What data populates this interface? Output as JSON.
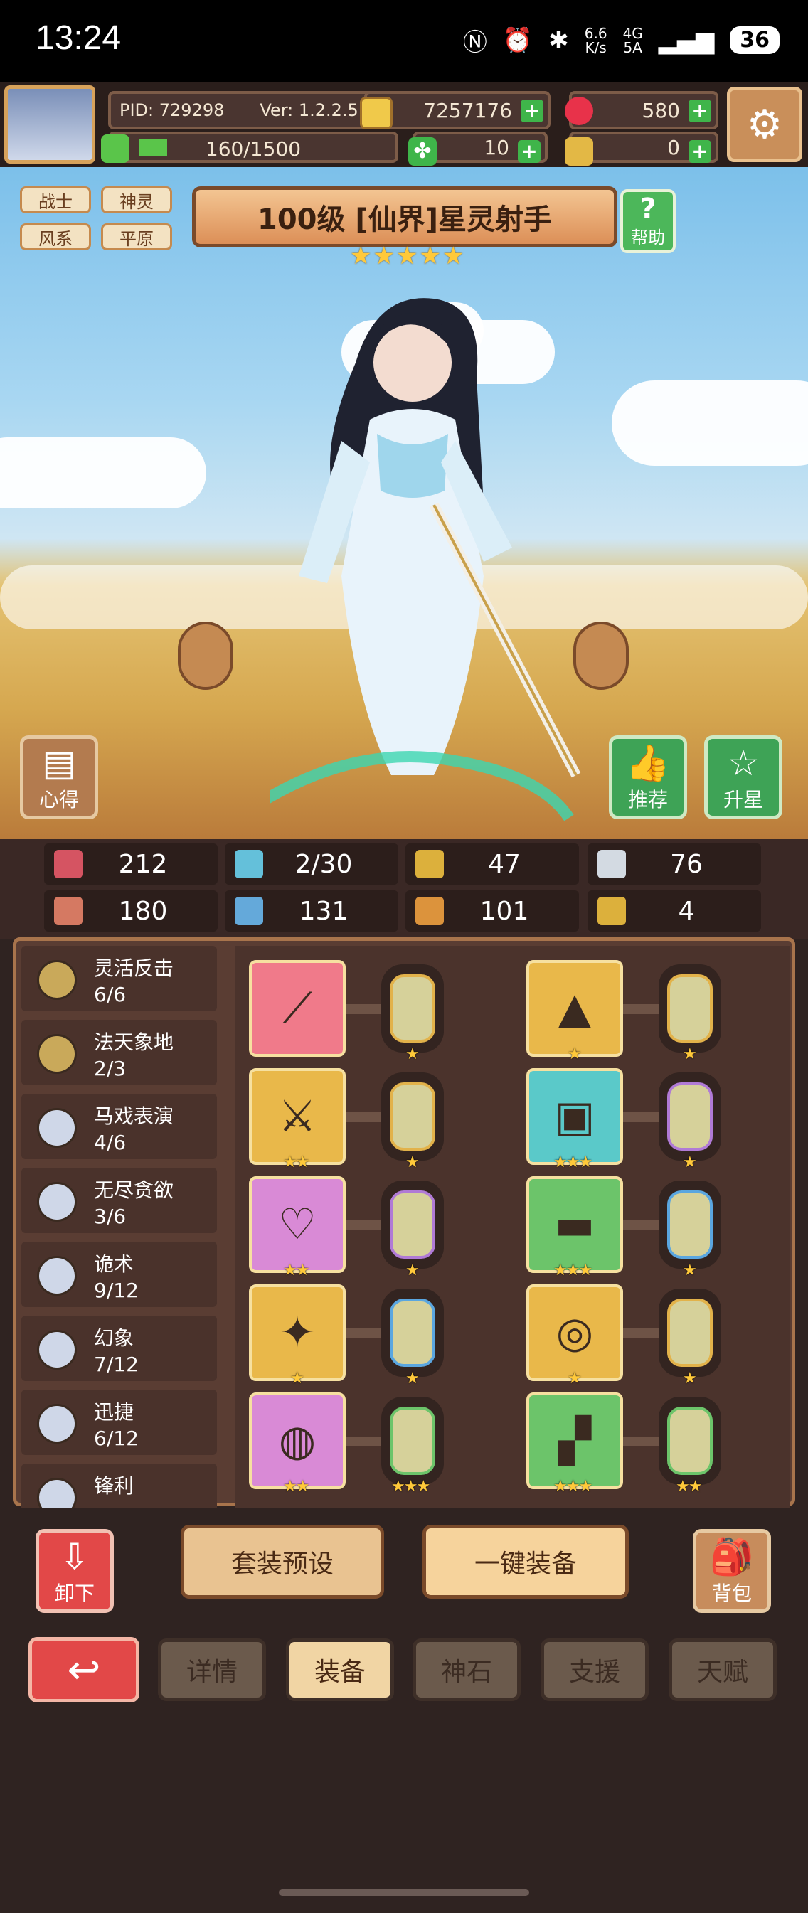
{
  "status_bar": {
    "time": "13:24",
    "net_speed": "6.6\nK/s",
    "net_type": "4G\n5A",
    "battery": "36"
  },
  "player": {
    "pid_label": "PID: 729298",
    "version_label": "Ver: 1.2.2.5",
    "gold": "7257176",
    "gems": "580",
    "exp": "160/1500",
    "exp_fraction": 0.107,
    "clover": "10",
    "keys": "0"
  },
  "hero": {
    "tags": [
      "战士",
      "神灵",
      "风系",
      "平原"
    ],
    "title": "100级 [仙界]星灵射手",
    "stars": 5,
    "help_label": "帮助",
    "left_button": "心得",
    "recommend_button": "推荐",
    "star_up_button": "升星"
  },
  "stats": [
    {
      "icon": "heart-icon",
      "value": "212",
      "color": "#e85a6a"
    },
    {
      "icon": "water-drop-icon",
      "value": "2/30",
      "color": "#6ad1f0"
    },
    {
      "icon": "shield-icon",
      "value": "47",
      "color": "#f0c040"
    },
    {
      "icon": "wing-icon",
      "value": "76",
      "color": "#e6eef8"
    },
    {
      "icon": "fist-icon",
      "value": "180",
      "color": "#e8836a"
    },
    {
      "icon": "spellbook-icon",
      "value": "131",
      "color": "#6ab8f0"
    },
    {
      "icon": "armor-icon",
      "value": "101",
      "color": "#f0a040"
    },
    {
      "icon": "horseshoe-icon",
      "value": "4",
      "color": "#f0c040"
    }
  ],
  "skills": [
    {
      "name": "灵活反击",
      "count": "6/6"
    },
    {
      "name": "法天象地",
      "count": "2/3"
    },
    {
      "name": "马戏表演",
      "count": "4/6"
    },
    {
      "name": "无尽贪欲",
      "count": "3/6"
    },
    {
      "name": "诡术",
      "count": "9/12"
    },
    {
      "name": "幻象",
      "count": "7/12"
    },
    {
      "name": "迅捷",
      "count": "6/12"
    },
    {
      "name": "锋利",
      "count": ""
    }
  ],
  "equipment": [
    {
      "slot_icon": "staff-icon",
      "bg": "#f07a8a",
      "stars": 0,
      "gem_border": "#e2b24a",
      "gem_stars": 1
    },
    {
      "slot_icon": "hat-icon",
      "bg": "#e9b84a",
      "stars": 1,
      "gem_border": "#e2b24a",
      "gem_stars": 1
    },
    {
      "slot_icon": "crossed-swords-icon",
      "bg": "#e9b84a",
      "stars": 2,
      "gem_border": "#e2b24a",
      "gem_stars": 1
    },
    {
      "slot_icon": "armor-vest-icon",
      "bg": "#5ac9c9",
      "stars": 3,
      "gem_border": "#b07ad6",
      "gem_stars": 1
    },
    {
      "slot_icon": "necklace-icon",
      "bg": "#d98ad6",
      "stars": 2,
      "gem_border": "#b07ad6",
      "gem_stars": 1
    },
    {
      "slot_icon": "bracer-icon",
      "bg": "#6cc46a",
      "stars": 3,
      "gem_border": "#5aa6e0",
      "gem_stars": 1
    },
    {
      "slot_icon": "amulet-icon",
      "bg": "#e9b84a",
      "stars": 1,
      "gem_border": "#5aa6e0",
      "gem_stars": 1
    },
    {
      "slot_icon": "belt-icon",
      "bg": "#e9b84a",
      "stars": 1,
      "gem_border": "#e2b24a",
      "gem_stars": 1
    },
    {
      "slot_icon": "ring-icon",
      "bg": "#d98ad6",
      "stars": 2,
      "gem_border": "#6cc46a",
      "gem_stars": 3
    },
    {
      "slot_icon": "boots-icon",
      "bg": "#6cc46a",
      "stars": 3,
      "gem_border": "#6cc46a",
      "gem_stars": 2
    }
  ],
  "actions": {
    "unload": "卸下",
    "preset": "套装预设",
    "one_key": "一键装备",
    "bag": "背包"
  },
  "tabs": [
    {
      "label": "详情",
      "active": false
    },
    {
      "label": "装备",
      "active": true
    },
    {
      "label": "神石",
      "active": false
    },
    {
      "label": "支援",
      "active": false
    },
    {
      "label": "天赋",
      "active": false
    }
  ]
}
